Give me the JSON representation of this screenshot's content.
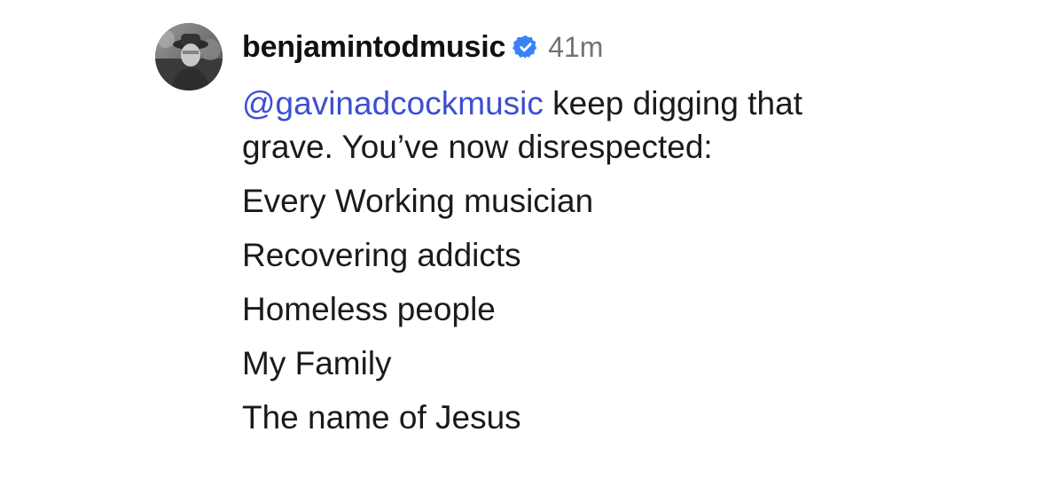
{
  "comment": {
    "username": "benjamintodmusic",
    "verified": true,
    "time_ago": "41m",
    "mention": "@gavinadcockmusic",
    "text_line1_rest": " keep digging that",
    "text_line2": "grave. You’ve now disrespected:",
    "list": [
      "Every Working musician",
      "Recovering addicts",
      "Homeless people",
      "My Family",
      "The name of Jesus"
    ]
  },
  "colors": {
    "mention": "#3c4fd0",
    "verified_badge": "#3b82f6",
    "time": "#737373"
  },
  "icons": {
    "avatar": "profile-photo",
    "verified": "verified-badge-icon"
  }
}
